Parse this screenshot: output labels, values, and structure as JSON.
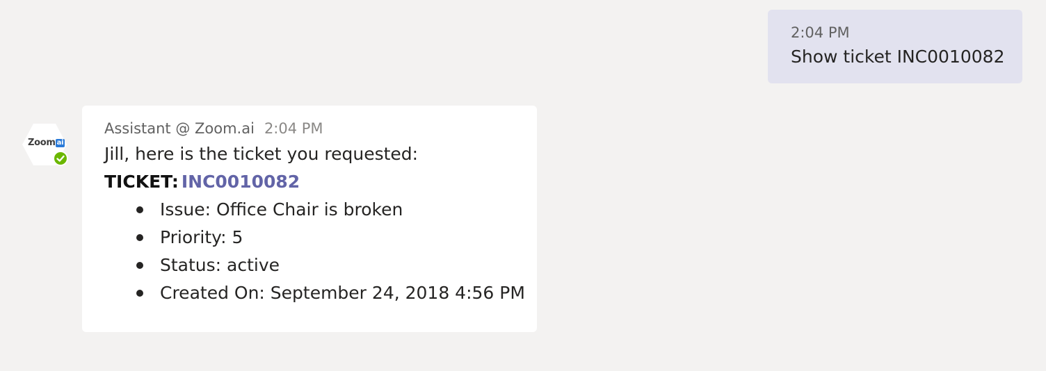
{
  "outgoing_message": {
    "time": "2:04 PM",
    "text": "Show ticket INC0010082"
  },
  "bot_message": {
    "avatar": {
      "logo_text": "Zoom",
      "logo_badge": "ai",
      "presence": "available-check-icon"
    },
    "sender": "Assistant @ Zoom.ai",
    "time": "2:04 PM",
    "intro": "Jill, here is the ticket you requested:",
    "ticket_label": "TICKET:",
    "ticket_id": "INC0010082",
    "details": [
      "Issue: Office Chair is broken",
      "Priority: 5",
      "Status: active",
      "Created On: September 24, 2018 4:56 PM"
    ]
  },
  "colors": {
    "background": "#f3f2f1",
    "outgoing_bubble": "#e2e2ef",
    "card": "#ffffff",
    "link": "#6264a7",
    "presence": "#6bb700"
  }
}
